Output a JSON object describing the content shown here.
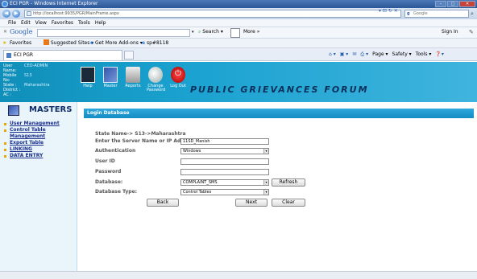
{
  "window": {
    "title": "ECI PGR - Windows Internet Explorer"
  },
  "address": {
    "url": "http://localhost:9935/PGR/MainFrame.aspx",
    "search_placeholder": "Google"
  },
  "menubar": [
    "File",
    "Edit",
    "View",
    "Favorites",
    "Tools",
    "Help"
  ],
  "google_toolbar": {
    "logo": "Google",
    "search_label": "Search",
    "more_label": "More »",
    "signin_label": "Sign In"
  },
  "favorites": {
    "label": "Favorites",
    "suggested": "Suggested Sites ▾",
    "addons": "Get More Add-ons ▾",
    "sp": "sp#8118"
  },
  "tab": {
    "label": "ECI PGR"
  },
  "commands": [
    "Page ▾",
    "Safety ▾",
    "Tools ▾"
  ],
  "user": {
    "rows": [
      {
        "k": "User Name:",
        "v": "CEO-ADMIN"
      },
      {
        "k": "Mobile No:",
        "v": "S13"
      },
      {
        "k": "State :",
        "v": "Maharashtra"
      },
      {
        "k": "District :",
        "v": ""
      },
      {
        "k": "AC :",
        "v": ""
      }
    ]
  },
  "header_buttons": {
    "help": "Help",
    "master": "Master",
    "reports": "Reports",
    "change_password": "Change Password",
    "logout": "Log Out"
  },
  "banner": "PUBLIC GRIEVANCES FORUM",
  "sidebar": {
    "title": "MASTERS",
    "items": [
      "User Management",
      "Control Table Management",
      "Export Table",
      "LINKING",
      "DATA ENTRY"
    ]
  },
  "login": {
    "header": "Login Database",
    "state_line": "State Name-> S13->Maharashtra",
    "server_label": "Enter the Server Name or IP Address",
    "server_value": "11SD_Manish",
    "auth_label": "Authentication",
    "auth_value": "Windows",
    "userid_label": "User ID",
    "userid_value": "",
    "password_label": "Password",
    "password_value": "",
    "database_label": "Database:",
    "database_value": "COMPLAINT_SMS",
    "refresh_label": "Refresh",
    "dbtype_label": "Database Type:",
    "dbtype_value": "Control Tables",
    "back_label": "Back",
    "next_label": "Next",
    "clear_label": "Clear"
  }
}
